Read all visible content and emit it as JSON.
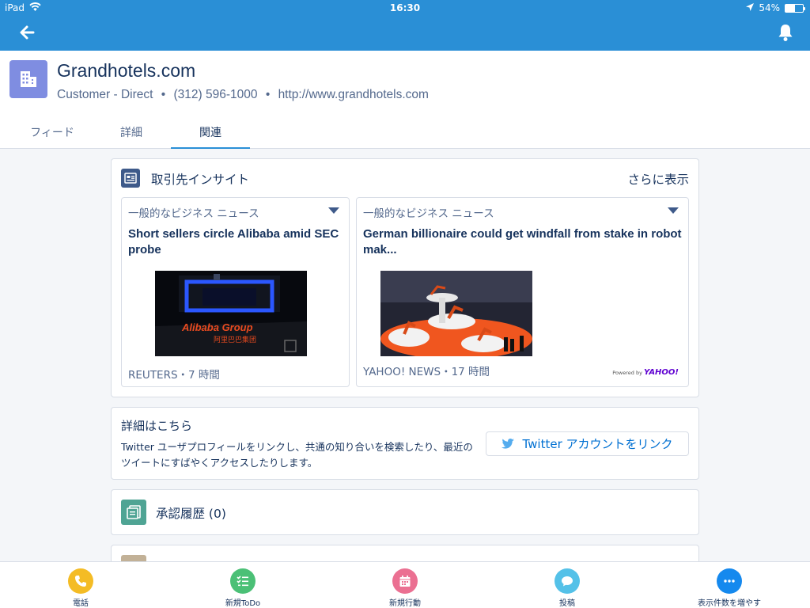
{
  "status_bar": {
    "device": "iPad",
    "time": "16:30",
    "battery": "54%",
    "battery_level": 0.54
  },
  "account": {
    "name": "Grandhotels.com",
    "type": "Customer - Direct",
    "phone": "(312) 596-1000",
    "website": "http://www.grandhotels.com",
    "separator": "•"
  },
  "tabs": [
    {
      "label": "フィード",
      "active": false
    },
    {
      "label": "詳細",
      "active": false
    },
    {
      "label": "関連",
      "active": true
    }
  ],
  "insights": {
    "title": "取引先インサイト",
    "more_label": "さらに表示",
    "articles": [
      {
        "category": "一般的なビジネス ニュース",
        "headline": "Short sellers circle Alibaba amid SEC probe",
        "source": "REUTERS・7 時間",
        "image": "alibaba-booth-photo",
        "image_text": "Alibaba Group",
        "image_subtext": "阿里巴巴集团"
      },
      {
        "category": "一般的なビジネス ニュース",
        "headline": "German billionaire could get windfall from stake in robot mak...",
        "source": "YAHOO! NEWS・17 時間",
        "image": "robot-arms-expo-photo",
        "powered_label": "Powered by",
        "powered_brand": "YAHOO!"
      }
    ]
  },
  "twitter": {
    "title": "詳細はこちら",
    "description": "Twitter ユーザプロフィールをリンクし、共通の知り合いを検索したり、最近のツイートにすばやくアクセスしたりします。",
    "button_label": "Twitter アカウントをリンク"
  },
  "approval": {
    "title": "承認履歴 (0)"
  },
  "actions": [
    {
      "label": "電話",
      "icon": "phone-icon",
      "color": "#f4bc25"
    },
    {
      "label": "新規ToDo",
      "icon": "task-icon",
      "color": "#4bc076"
    },
    {
      "label": "新規行動",
      "icon": "calendar-icon",
      "color": "#eb7092"
    },
    {
      "label": "投稿",
      "icon": "post-icon",
      "color": "#54c1e8"
    },
    {
      "label": "表示件数を増やす",
      "icon": "more-icon",
      "color": "#1589ee"
    }
  ],
  "colors": {
    "nav": "#2a8fd6",
    "account_icon": "#7f8de1",
    "text": "#16325c",
    "muted": "#54698d",
    "link": "#0070d2"
  }
}
